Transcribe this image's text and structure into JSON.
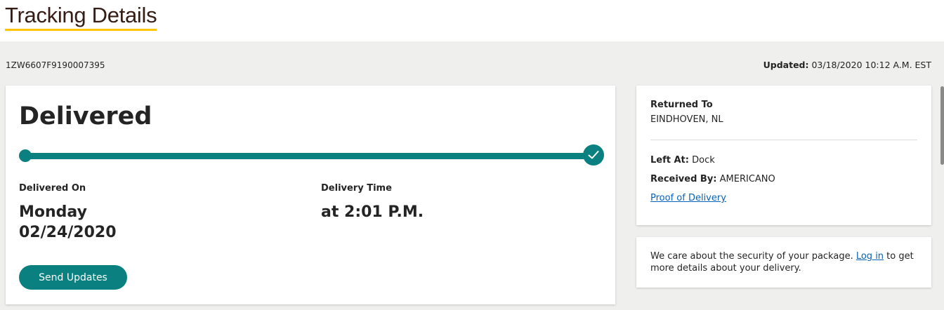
{
  "header": {
    "title": "Tracking Details"
  },
  "summary": {
    "tracking_number": "1ZW6607F9190007395",
    "updated_label": "Updated:",
    "updated_value": " 03/18/2020 10:12 A.M. EST"
  },
  "status": {
    "title": "Delivered",
    "progress": 1.0,
    "delivered_on_label": "Delivered On",
    "delivered_on_day": "Monday",
    "delivered_on_date": "02/24/2020",
    "delivery_time_label": "Delivery Time",
    "delivery_time_value": "at 2:01 P.M.",
    "send_updates_label": "Send Updates"
  },
  "details": {
    "returned_to_label": "Returned To",
    "returned_to_value": "EINDHOVEN, NL",
    "left_at_label": "Left At:",
    "left_at_value": " Dock",
    "received_by_label": "Received By:",
    "received_by_value": " AMERICANO",
    "proof_link": "Proof of Delivery"
  },
  "security": {
    "text_before": "We care about the security of your package. ",
    "login_link": "Log in",
    "text_after": " to get more details about your delivery."
  },
  "colors": {
    "accent": "#0a8080",
    "title": "#351c15",
    "underline": "#ffc400",
    "link": "#0662bb",
    "background": "#efefee"
  },
  "icons": {
    "check": "check-icon"
  }
}
